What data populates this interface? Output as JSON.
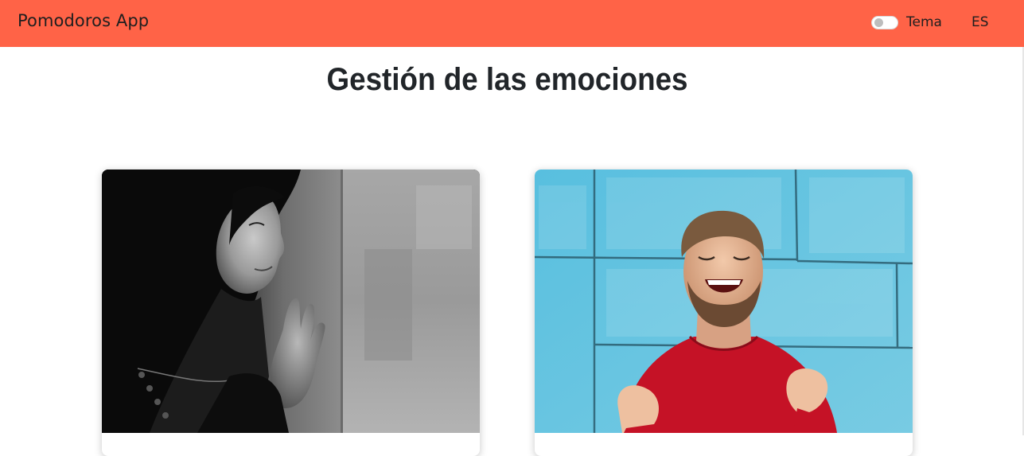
{
  "navbar": {
    "brand": "Pomodoros App",
    "theme_toggle": {
      "label": "Tema",
      "checked": false
    },
    "language": "ES",
    "color": "#ff6347"
  },
  "main": {
    "title": "Gestión de las emociones"
  },
  "cards": [
    {
      "image": "sad-woman-at-window-photo"
    },
    {
      "image": "happy-man-celebrating-photo"
    }
  ]
}
